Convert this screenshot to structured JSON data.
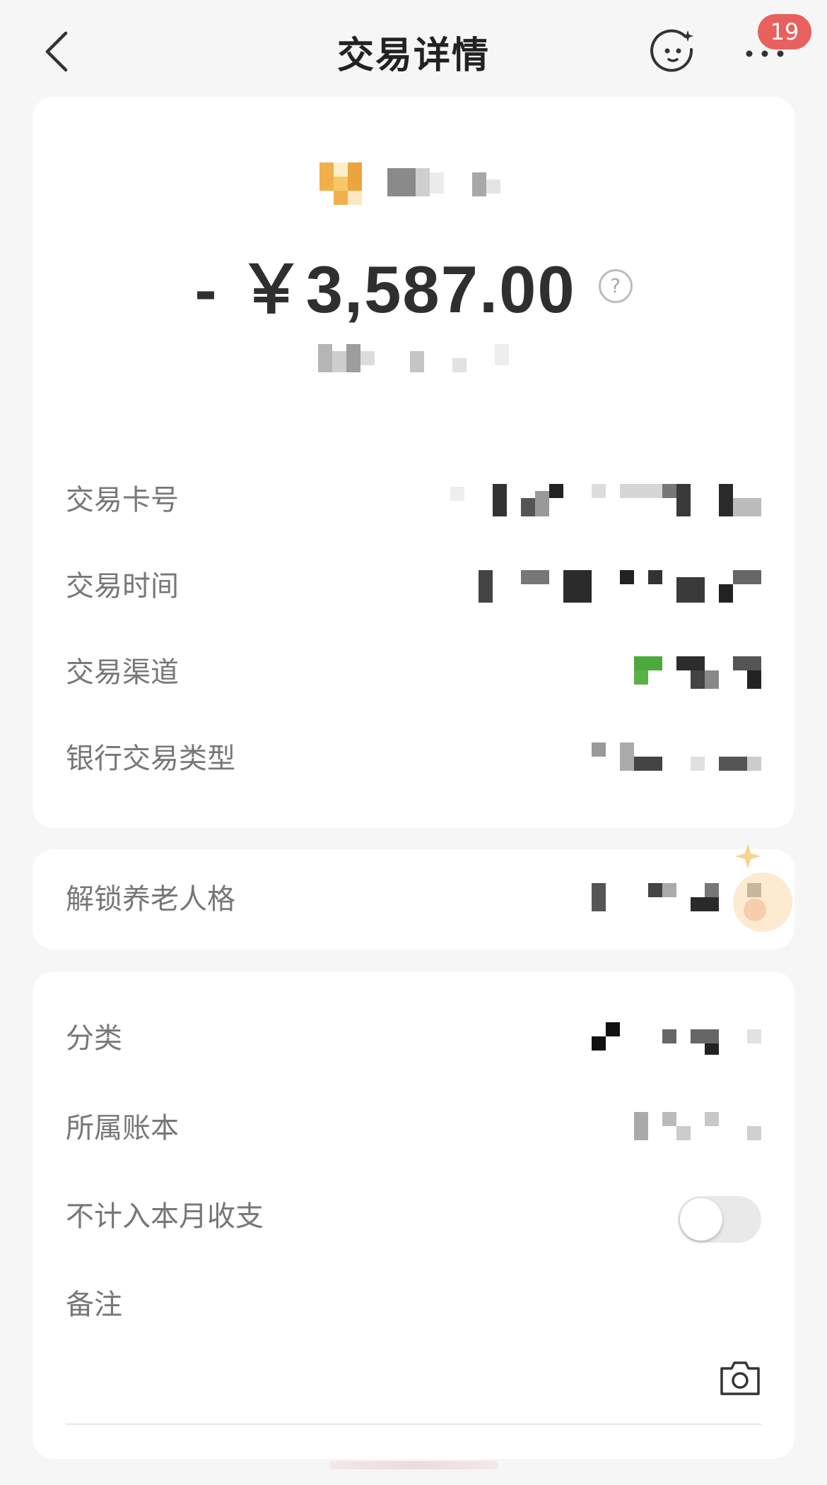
{
  "nav": {
    "title": "交易详情",
    "badge_count": "19",
    "back_icon": "chevron-left-icon",
    "face_icon": "smiley-face-icon",
    "more_icon": "more-dots-icon"
  },
  "summary": {
    "amount": "- ￥3,587.00",
    "help_icon": "question-circle-icon"
  },
  "details": [
    {
      "label": "交易卡号"
    },
    {
      "label": "交易时间"
    },
    {
      "label": "交易渠道"
    },
    {
      "label": "银行交易类型"
    }
  ],
  "pension": {
    "label": "解锁养老人格"
  },
  "bookkeeping": {
    "category_label": "分类",
    "ledger_label": "所属账本",
    "exclude_label": "不计入本月收支",
    "exclude_enabled": false,
    "note_label": "备注",
    "camera_icon": "camera-icon"
  },
  "colors": {
    "badge": "#e8615e",
    "background": "#f6f6f6",
    "card": "#ffffff",
    "label": "#777777"
  }
}
